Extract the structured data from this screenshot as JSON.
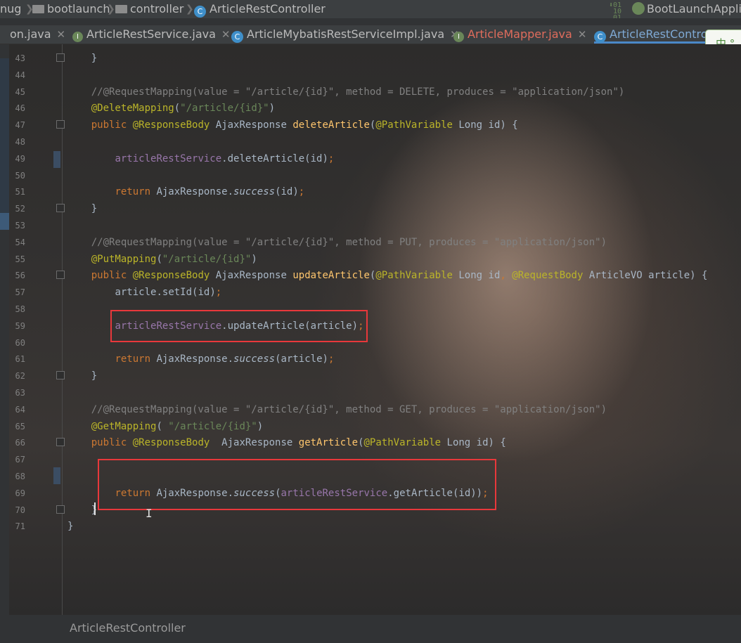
{
  "breadcrumb": {
    "items": [
      {
        "label": "nug",
        "icon": ""
      },
      {
        "label": "bootlaunch",
        "icon": "folder-icon"
      },
      {
        "label": "controller",
        "icon": "folder-icon"
      },
      {
        "label": "ArticleRestController",
        "icon": "class-icon"
      }
    ],
    "run_config": "BootLaunchApplic"
  },
  "tabs": [
    {
      "label": "on.java",
      "icon": ""
    },
    {
      "label": "ArticleRestService.java",
      "icon": "interface-icon"
    },
    {
      "label": "ArticleMybatisRestServiceImpl.java",
      "icon": "class-icon"
    },
    {
      "label": "ArticleMapper.java",
      "icon": "interface-icon"
    },
    {
      "label": "ArticleRestControl",
      "icon": "class-icon"
    }
  ],
  "ime": {
    "label": "中 °"
  },
  "code_lines": [
    {
      "n": "43",
      "text": "    }"
    },
    {
      "n": "44",
      "text": ""
    },
    {
      "n": "45",
      "text": "    //@RequestMapping(value = \"/article/{id}\", method = DELETE, produces = \"application/json\")"
    },
    {
      "n": "46",
      "text": "    @DeleteMapping(\"/article/{id}\")"
    },
    {
      "n": "47",
      "text": "    public @ResponseBody AjaxResponse deleteArticle(@PathVariable Long id) {"
    },
    {
      "n": "48",
      "text": ""
    },
    {
      "n": "49",
      "text": "        articleRestService.deleteArticle(id);"
    },
    {
      "n": "50",
      "text": ""
    },
    {
      "n": "51",
      "text": "        return AjaxResponse.success(id);"
    },
    {
      "n": "52",
      "text": "    }"
    },
    {
      "n": "53",
      "text": ""
    },
    {
      "n": "54",
      "text": "    //@RequestMapping(value = \"/article/{id}\", method = PUT, produces = \"application/json\")"
    },
    {
      "n": "55",
      "text": "    @PutMapping(\"/article/{id}\")"
    },
    {
      "n": "56",
      "text": "    public @ResponseBody AjaxResponse updateArticle(@PathVariable Long id, @RequestBody ArticleVO article) {"
    },
    {
      "n": "57",
      "text": "        article.setId(id);"
    },
    {
      "n": "58",
      "text": ""
    },
    {
      "n": "59",
      "text": "        articleRestService.updateArticle(article);"
    },
    {
      "n": "60",
      "text": ""
    },
    {
      "n": "61",
      "text": "        return AjaxResponse.success(article);"
    },
    {
      "n": "62",
      "text": "    }"
    },
    {
      "n": "63",
      "text": ""
    },
    {
      "n": "64",
      "text": "    //@RequestMapping(value = \"/article/{id}\", method = GET, produces = \"application/json\")"
    },
    {
      "n": "65",
      "text": "    @GetMapping( \"/article/{id}\")"
    },
    {
      "n": "66",
      "text": "    public @ResponseBody  AjaxResponse getArticle(@PathVariable Long id) {"
    },
    {
      "n": "67",
      "text": ""
    },
    {
      "n": "68",
      "text": ""
    },
    {
      "n": "69",
      "text": "        return AjaxResponse.success(articleRestService.getArticle(id));"
    },
    {
      "n": "70",
      "text": "    }"
    },
    {
      "n": "71",
      "text": "}"
    }
  ],
  "status": {
    "breadcrumb_label": "ArticleRestController"
  },
  "colors": {
    "highlight_box": "#e8383b",
    "keyword": "#cc7832",
    "annotation": "#bbb529",
    "string": "#6a8759",
    "method": "#ffc66d",
    "field": "#9876aa"
  }
}
